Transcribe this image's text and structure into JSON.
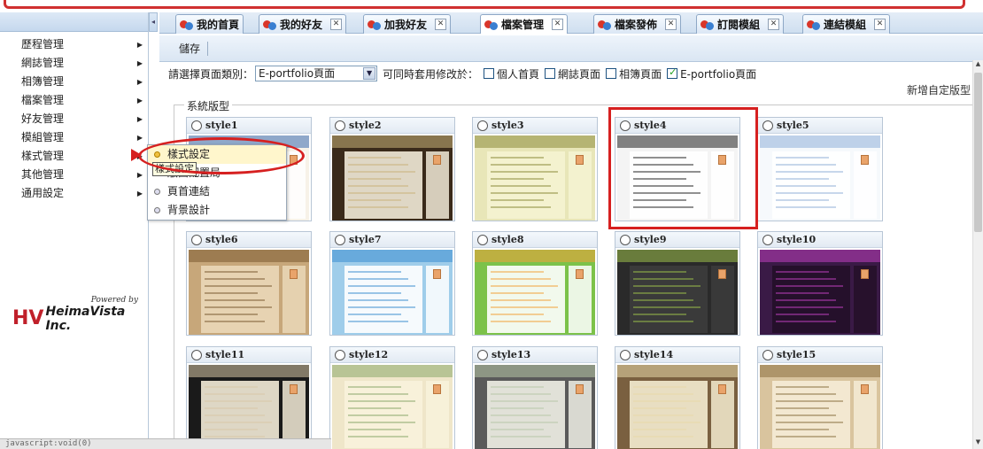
{
  "tabs": [
    {
      "label": "我的首頁",
      "closable": false,
      "active": false
    },
    {
      "label": "我的好友",
      "closable": true,
      "active": false
    },
    {
      "label": "加我好友",
      "closable": true,
      "active": false
    },
    {
      "label": "檔案管理",
      "closable": true,
      "active": true
    },
    {
      "label": "檔案發佈",
      "closable": true,
      "active": false
    },
    {
      "label": "訂閱模組",
      "closable": true,
      "active": false
    },
    {
      "label": "連結模組",
      "closable": true,
      "active": false
    }
  ],
  "sidebar": {
    "items": [
      {
        "label": "歷程管理"
      },
      {
        "label": "網誌管理"
      },
      {
        "label": "相簿管理"
      },
      {
        "label": "檔案管理"
      },
      {
        "label": "好友管理"
      },
      {
        "label": "模組管理"
      },
      {
        "label": "樣式管理"
      },
      {
        "label": "其他管理"
      },
      {
        "label": "通用設定"
      }
    ],
    "powered_by": "Powered by",
    "brand_name": "HeimaVista Inc."
  },
  "flyout": {
    "items": [
      {
        "label": "樣式設定",
        "active": true
      },
      {
        "label": "版面配置局",
        "active": false
      },
      {
        "label": "頁首連結",
        "active": false
      },
      {
        "label": "背景設計",
        "active": false
      }
    ],
    "tooltip": "樣式設定"
  },
  "toolbar": {
    "save_label": "儲存"
  },
  "filter": {
    "label": "請選擇頁面類別：",
    "select_value": "E-portfolio頁面",
    "apply_label": "可同時套用修改於：",
    "checkboxes": [
      {
        "label": "個人首頁",
        "checked": false
      },
      {
        "label": "網誌頁面",
        "checked": false
      },
      {
        "label": "相簿頁面",
        "checked": false
      },
      {
        "label": "E-portfolio頁面",
        "checked": true
      }
    ]
  },
  "new_custom_label": "新增自定版型",
  "section_title": "系統版型",
  "styles": [
    {
      "name": "style1",
      "bg": "#f7f2e8",
      "accent": "#3a6bb0",
      "panel": "#ffffff"
    },
    {
      "name": "style2",
      "bg": "#3a2a1a",
      "accent": "#c9b27a",
      "panel": "#f2ead8"
    },
    {
      "name": "style3",
      "bg": "#e8e6b8",
      "accent": "#8a8a3a",
      "panel": "#f5f3d2"
    },
    {
      "name": "style4",
      "bg": "#f4f4f4",
      "accent": "#222222",
      "panel": "#ffffff"
    },
    {
      "name": "style5",
      "bg": "#f6f9fc",
      "accent": "#8fb0d8",
      "panel": "#ffffff"
    },
    {
      "name": "style6",
      "bg": "#c7a77a",
      "accent": "#7a5a30",
      "panel": "#ead8b8"
    },
    {
      "name": "style7",
      "bg": "#9fcdea",
      "accent": "#3b8ed0",
      "panel": "#ffffff"
    },
    {
      "name": "style8",
      "bg": "#7cc24a",
      "accent": "#f2a23a",
      "panel": "#ffffff"
    },
    {
      "name": "style9",
      "bg": "#2a2a2a",
      "accent": "#9cc04a",
      "panel": "#3c3c3c"
    },
    {
      "name": "style10",
      "bg": "#3a1a46",
      "accent": "#c040c0",
      "panel": "#241028"
    },
    {
      "name": "style11",
      "bg": "#1a1a1a",
      "accent": "#d8c8a8",
      "panel": "#f4ecd8"
    },
    {
      "name": "style12",
      "bg": "#efe6c9",
      "accent": "#8aa86a",
      "panel": "#f8f2dc"
    },
    {
      "name": "style13",
      "bg": "#5a5a5a",
      "accent": "#b8c8a8",
      "panel": "#f0f0e6"
    },
    {
      "name": "style14",
      "bg": "#7a6040",
      "accent": "#e8d8a8",
      "panel": "#f4ecd0"
    },
    {
      "name": "style15",
      "bg": "#d9c49e",
      "accent": "#8a7040",
      "panel": "#f5ecd6"
    }
  ],
  "status_text": "javascript:void(0)"
}
